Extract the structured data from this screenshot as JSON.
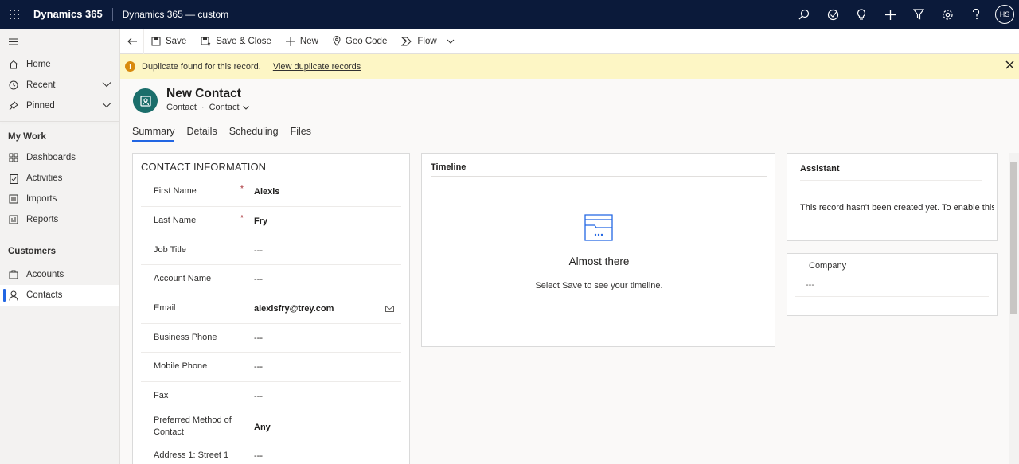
{
  "topbar": {
    "brand": "Dynamics 365",
    "app_name": "Dynamics 365 — custom",
    "avatar_initials": "HS",
    "icons": [
      "search-icon",
      "task-icon",
      "lightbulb-icon",
      "plus-icon",
      "filter-icon",
      "settings-icon",
      "help-icon"
    ]
  },
  "sidebar": {
    "items": [
      {
        "label": "Home",
        "icon": "home-icon"
      },
      {
        "label": "Recent",
        "icon": "clock-icon"
      },
      {
        "label": "Pinned",
        "icon": "pin-icon"
      }
    ],
    "groups": [
      {
        "title": "My Work",
        "items": [
          {
            "label": "Dashboards",
            "icon": "dashboard-icon"
          },
          {
            "label": "Activities",
            "icon": "activities-icon"
          },
          {
            "label": "Imports",
            "icon": "imports-icon"
          },
          {
            "label": "Reports",
            "icon": "reports-icon"
          }
        ]
      },
      {
        "title": "Customers",
        "items": [
          {
            "label": "Accounts",
            "icon": "accounts-icon"
          },
          {
            "label": "Contacts",
            "icon": "contact-icon",
            "selected": true
          }
        ]
      }
    ]
  },
  "commands": {
    "save": "Save",
    "save_close": "Save & Close",
    "new": "New",
    "geo_code": "Geo Code",
    "flow": "Flow"
  },
  "notification": {
    "message": "Duplicate found for this record.",
    "link": "View duplicate records"
  },
  "record": {
    "title": "New Contact",
    "entity": "Contact",
    "form": "Contact"
  },
  "tabs": [
    "Summary",
    "Details",
    "Scheduling",
    "Files"
  ],
  "contact_info": {
    "title": "CONTACT INFORMATION",
    "fields": [
      {
        "label": "First Name",
        "value": "Alexis",
        "required": true
      },
      {
        "label": "Last Name",
        "value": "Fry",
        "required": true
      },
      {
        "label": "Job Title",
        "value": "---"
      },
      {
        "label": "Account Name",
        "value": "---"
      },
      {
        "label": "Email",
        "value": "alexisfry@trey.com"
      },
      {
        "label": "Business Phone",
        "value": "---"
      },
      {
        "label": "Mobile Phone",
        "value": "---"
      },
      {
        "label": "Fax",
        "value": "---"
      },
      {
        "label": "Preferred Method of Contact",
        "value": "Any"
      },
      {
        "label": "Address 1: Street 1",
        "value": "---"
      }
    ],
    "required_mark": "*"
  },
  "timeline": {
    "title": "Timeline",
    "heading": "Almost there",
    "text": "Select Save to see your timeline."
  },
  "assistant": {
    "title": "Assistant",
    "text": "This record hasn't been created yet. To enable this"
  },
  "company": {
    "label": "Company",
    "value": "---"
  },
  "colors": {
    "topbar": "#0b1a3a",
    "accent": "#2266e3",
    "notification_bg": "#fdf6c5",
    "record_icon": "#1b6e6b",
    "required": "#a4262c"
  }
}
